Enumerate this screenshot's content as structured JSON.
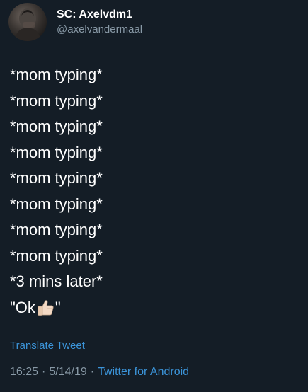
{
  "author": {
    "display_name": "SC: Axelvdm1",
    "handle": "@axelvandermaal"
  },
  "tweet": {
    "lines": [
      "*mom typing*",
      "*mom typing*",
      "*mom typing*",
      "*mom typing*",
      "*mom typing*",
      "*mom typing*",
      "*mom typing*",
      "*mom typing*",
      "*3 mins later*"
    ],
    "final_line_start": "\"Ok",
    "final_line_icon": "thumbs-up-icon",
    "final_line_end": "\""
  },
  "translate_label": "Translate Tweet",
  "meta": {
    "time": "16:25",
    "separator": "·",
    "date": "5/14/19",
    "source": "Twitter for Android"
  },
  "colors": {
    "background": "#141d26",
    "text": "#ffffff",
    "secondary": "#8899a6",
    "link": "#3b94d9"
  }
}
